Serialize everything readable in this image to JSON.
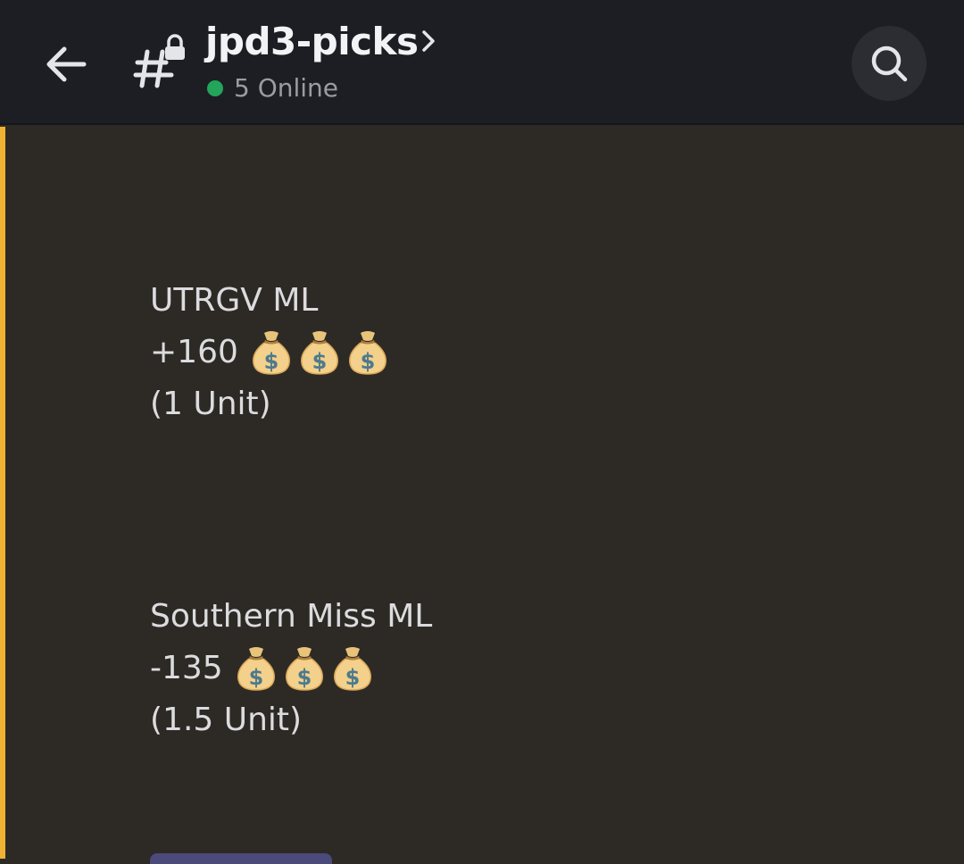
{
  "header": {
    "channel_name": "jpd3-picks",
    "online_text": "5 Online"
  },
  "colors": {
    "accent_bar": "#f0b232",
    "online_dot": "#23a55a",
    "header_bg": "#1d1e23",
    "content_bg": "#2d2a26"
  },
  "icons": {
    "back": "arrow-left-icon",
    "channel": "locked-hashtag-icon",
    "chevron": "chevron-right-icon",
    "search": "search-icon",
    "money_bag": "money-bag-emoji"
  },
  "message": {
    "picks": [
      {
        "team": "UTRGV ML",
        "odds": "+160",
        "units": "(1 Unit)",
        "emoji_count": 3
      },
      {
        "team": "Southern Miss ML",
        "odds": "-135",
        "units": "(1.5 Unit)",
        "emoji_count": 3
      }
    ]
  }
}
